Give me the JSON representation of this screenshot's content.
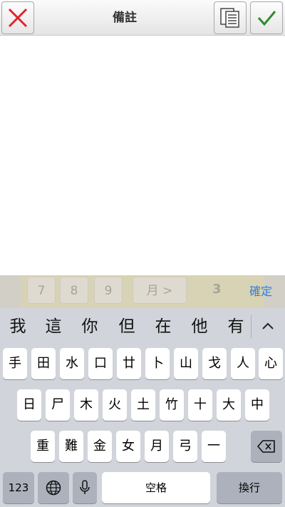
{
  "header": {
    "title": "備註"
  },
  "picker": {
    "cells": [
      "7",
      "8",
      "9"
    ],
    "month_cell": "月 >",
    "number": "3",
    "confirm": "確定"
  },
  "keyboard": {
    "candidates": [
      "我",
      "這",
      "你",
      "但",
      "在",
      "他",
      "有"
    ],
    "row1": [
      "手",
      "田",
      "水",
      "口",
      "廿",
      "卜",
      "山",
      "戈",
      "人",
      "心"
    ],
    "row2": [
      "日",
      "尸",
      "木",
      "火",
      "土",
      "竹",
      "十",
      "大",
      "中"
    ],
    "row3": [
      "重",
      "難",
      "金",
      "女",
      "月",
      "弓",
      "一"
    ],
    "numbers_key": "123",
    "space_key": "空格",
    "return_key": "換行"
  },
  "colors": {
    "cancel": "#e0242a",
    "ok": "#2e8b2e",
    "confirm": "#2f7fd8"
  }
}
